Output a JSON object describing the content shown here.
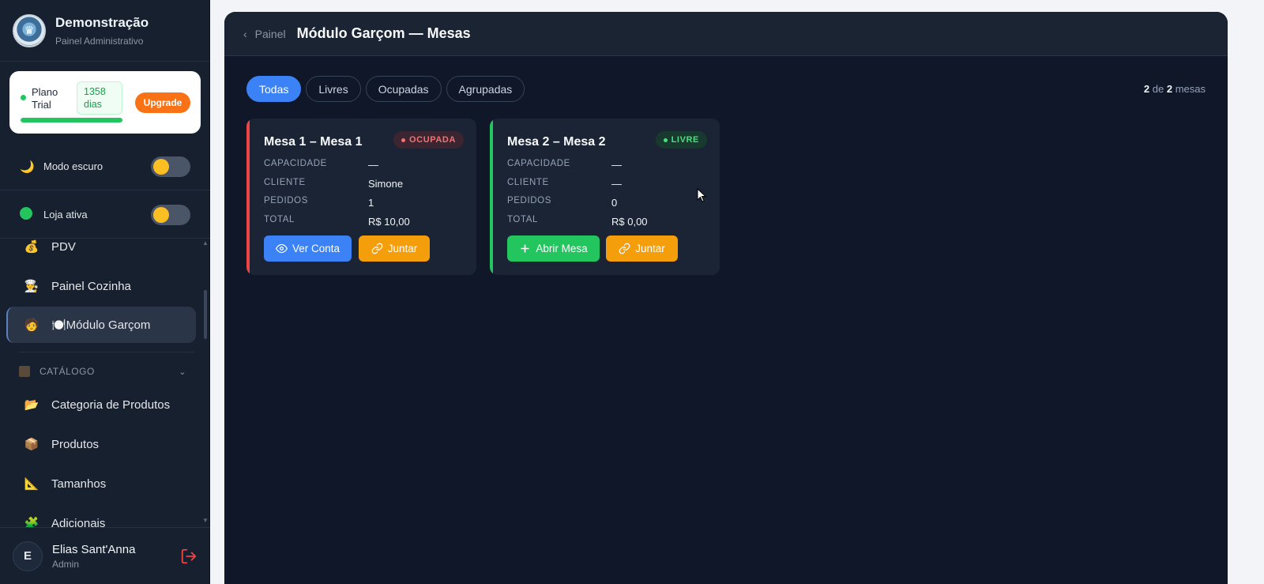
{
  "brand": {
    "name": "Demonstração",
    "subtitle": "Painel Administrativo"
  },
  "plan": {
    "label": "Plano Trial",
    "days": "1358 dias",
    "upgrade_label": "Upgrade",
    "progress": 1.0
  },
  "toggles": {
    "dark_mode": {
      "label": "Modo escuro",
      "icon": "moon-icon"
    },
    "store_active": {
      "label": "Loja ativa",
      "icon": "green-status-icon"
    }
  },
  "menu": {
    "items": [
      {
        "label": "PDV",
        "icon": "money-bag-icon",
        "glyph": "💰"
      },
      {
        "label": "Painel Cozinha",
        "icon": "chef-icon",
        "glyph": "👨‍🍳"
      },
      {
        "label": "🍽️Módulo Garçom",
        "icon": "waiter-icon",
        "glyph": "🧑",
        "active": true
      }
    ],
    "section_catalog": "CATÁLOGO",
    "catalog_items": [
      {
        "label": "Categoria de Produtos",
        "icon": "folder-icon",
        "glyph": "📂"
      },
      {
        "label": "Produtos",
        "icon": "box-icon",
        "glyph": "📦"
      },
      {
        "label": "Tamanhos",
        "icon": "ruler-icon",
        "glyph": "📐"
      },
      {
        "label": "Adicionais",
        "icon": "puzzle-icon",
        "glyph": "🧩"
      }
    ]
  },
  "user": {
    "initial": "E",
    "name": "Elias Sant'Anna",
    "role": "Admin"
  },
  "header": {
    "breadcrumb": "Painel",
    "title": "Módulo Garçom — Mesas"
  },
  "filters": [
    "Todas",
    "Livres",
    "Ocupadas",
    "Agrupadas"
  ],
  "active_filter": "Todas",
  "count": {
    "shown": "2",
    "sep": "de",
    "total": "2",
    "unit": "mesas"
  },
  "labels": {
    "capacity": "CAPACIDADE",
    "client": "CLIENTE",
    "orders": "PEDIDOS",
    "total": "TOTAL"
  },
  "colors": {
    "occupied": "#ef4444",
    "free": "#22c55e",
    "primary": "#3b82f6",
    "warning": "#f59e0b"
  },
  "tables": [
    {
      "title": "Mesa 1 – Mesa 1",
      "status": "OCUPADA",
      "capacity": "—",
      "client": "Simone",
      "orders": "1",
      "total": "R$ 10,00",
      "primary_action": "Ver Conta",
      "secondary_action": "Juntar"
    },
    {
      "title": "Mesa 2 – Mesa 2",
      "status": "LIVRE",
      "capacity": "—",
      "client": "—",
      "orders": "0",
      "total": "R$ 0,00",
      "primary_action": "Abrir Mesa",
      "secondary_action": "Juntar"
    }
  ]
}
